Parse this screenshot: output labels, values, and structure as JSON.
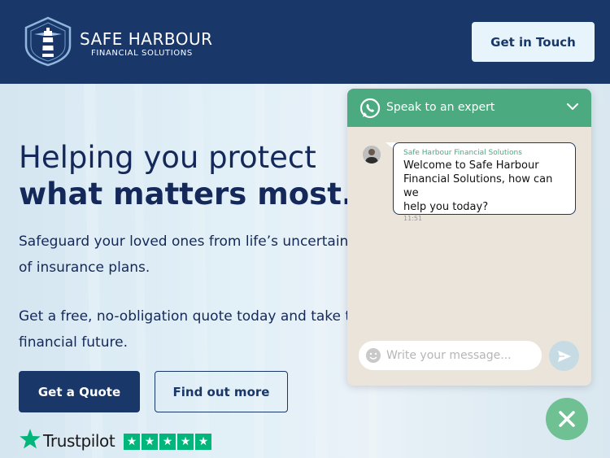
{
  "header": {
    "brand_name": "SAFE HARBOUR",
    "brand_sub": "FINANCIAL SOLUTIONS",
    "cta_label": "Get in Touch"
  },
  "hero": {
    "headline_line1": "Helping you protect",
    "headline_line2": "what matters most.",
    "para1_line1": "Safeguard your loved ones from life’s uncertaint",
    "para1_line2": "of insurance plans.",
    "para2_line1": "Get a free, no-obligation quote today and take t",
    "para2_line2": "financial future.",
    "primary_button": "Get a Quote",
    "secondary_button": "Find out more",
    "trustpilot_label": "Trustpilot",
    "trustpilot_stars": 5
  },
  "chat": {
    "title": "Speak to an expert",
    "message_from": "Safe Harbour Financial Solutions",
    "message_text_line1": "Welcome to Safe Harbour",
    "message_text_line2": "Financial Solutions, how can we",
    "message_text_line3": "help you today?",
    "message_time": "11:51",
    "input_placeholder": "Write your message..."
  },
  "colors": {
    "navy": "#1a376a",
    "whatsapp_green": "#4caa80",
    "trustpilot_green": "#00b67a"
  },
  "icons": [
    "lighthouse-logo-icon",
    "whatsapp-icon",
    "chevron-down-icon",
    "smiley-icon",
    "send-icon",
    "close-icon",
    "trustpilot-star-icon"
  ]
}
